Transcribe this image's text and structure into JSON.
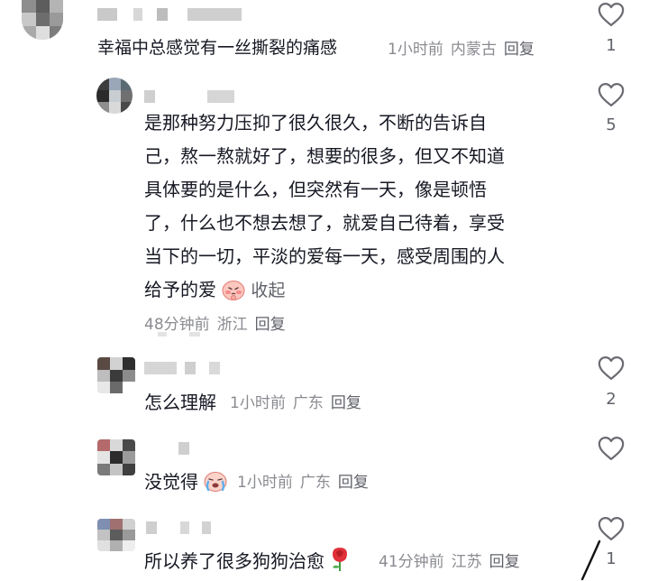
{
  "comments": [
    {
      "text": "幸福中总感觉有一丝撕裂的痛感",
      "time": "1小时前",
      "location": "内蒙古",
      "reply": "回复",
      "likes": "1"
    },
    {
      "text": "是那种努力压抑了很久很久，不断的告诉自己，熬一熬就好了，想要的很多，但又不知道具体要的是什么，但突然有一天，像是顿悟了，什么也不想去想了，就爱自己待着，享受当下的一切，平淡的爱每一天，感受周围的人给予的爱",
      "lines": [
        "是那种努力压抑了很久很久，不断的告诉自",
        "己，熬一熬就好了，想要的很多，但又不知道",
        "具体要的是什么，但突然有一天，像是顿悟",
        "了，什么也不想去想了，就爱自己待着，享受",
        "当下的一切，平淡的爱每一天，感受周围的人",
        "给予的爱"
      ],
      "collapse": "收起",
      "time": "48分钟前",
      "location": "浙江",
      "reply": "回复",
      "likes": "5"
    },
    {
      "text": "怎么理解",
      "time": "1小时前",
      "location": "广东",
      "reply": "回复",
      "likes": "2"
    },
    {
      "text": "没觉得",
      "time": "1小时前",
      "location": "广东",
      "reply": "回复",
      "likes": ""
    },
    {
      "text": "所以养了很多狗狗治愈",
      "time": "41分钟前",
      "location": "江苏",
      "reply": "回复",
      "likes": "1"
    }
  ],
  "icons": {
    "like": "heart-outline-icon",
    "emoji_shy": "blushing-face-emoji",
    "emoji_cry": "crying-face-emoji",
    "emoji_rose": "rose-emoji"
  },
  "colors": {
    "text": "#161823",
    "meta": "#8a8b91",
    "reply": "#60626a",
    "heart_stroke": "#6b6c72"
  }
}
